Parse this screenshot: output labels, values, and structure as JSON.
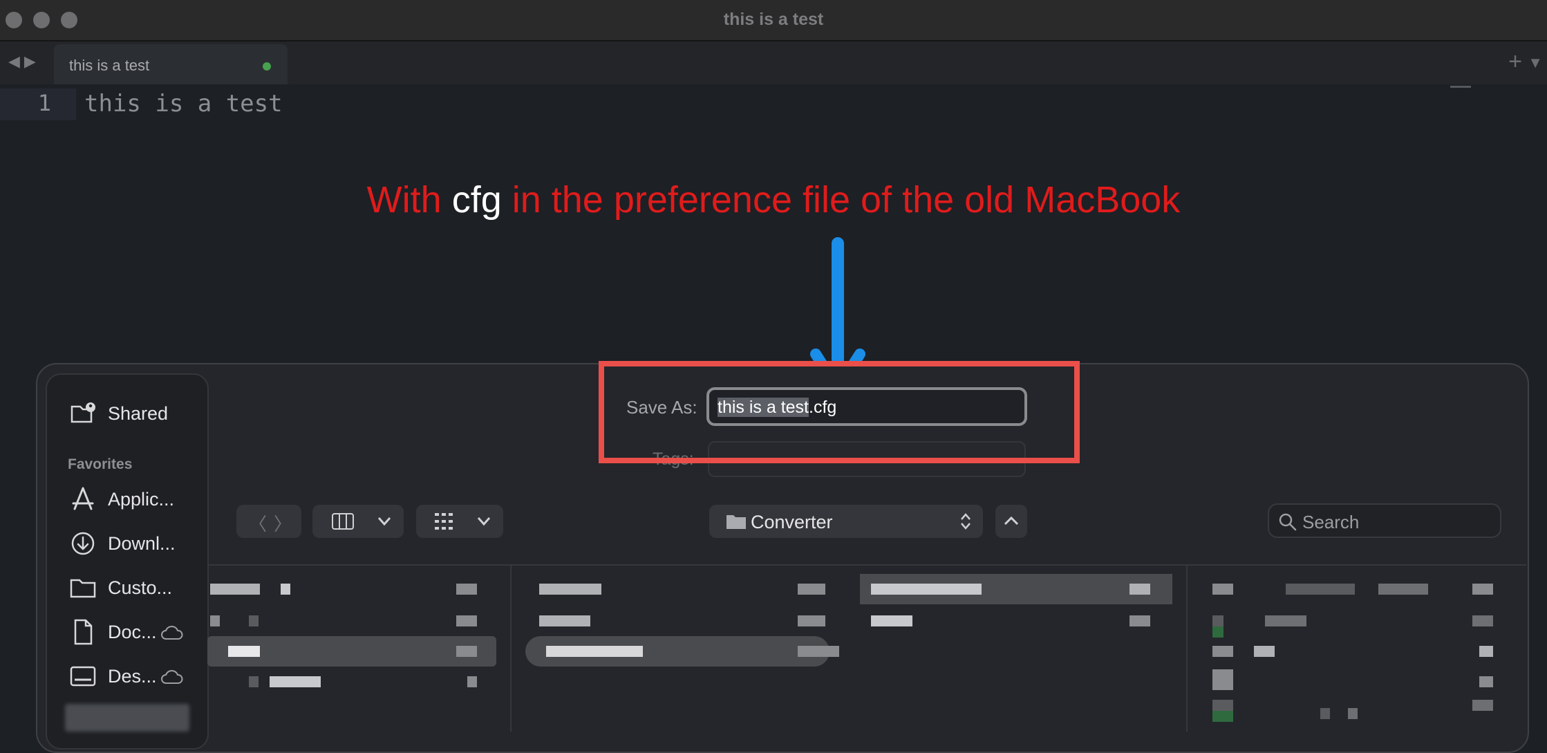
{
  "window": {
    "title": "this is a test"
  },
  "tab": {
    "label": "this is a test"
  },
  "editor": {
    "line_number": "1",
    "line_text": "this is a test"
  },
  "annotation": {
    "prefix": "With ",
    "highlight": "cfg",
    "suffix": " in the preference file of the old MacBook"
  },
  "sidebar": {
    "shared_label": "Shared",
    "favorites_header": "Favorites",
    "items": [
      {
        "label": "Applic...",
        "icon": "applications-icon"
      },
      {
        "label": "Downl...",
        "icon": "downloads-icon"
      },
      {
        "label": "Custo...",
        "icon": "folder-icon"
      },
      {
        "label": "Doc...",
        "icon": "document-icon",
        "cloud": true
      },
      {
        "label": "Des...",
        "icon": "desktop-icon",
        "cloud": true
      }
    ]
  },
  "save_dialog": {
    "save_as_label": "Save As:",
    "filename_selected": "this is a test",
    "filename_extension": ".cfg",
    "tags_label": "Tags:",
    "location": "Converter",
    "search_placeholder": "Search"
  },
  "colors": {
    "annotation_red": "#e01b1b",
    "highlight_box": "#ea4f4a",
    "arrow_blue": "#1a8ee8"
  }
}
